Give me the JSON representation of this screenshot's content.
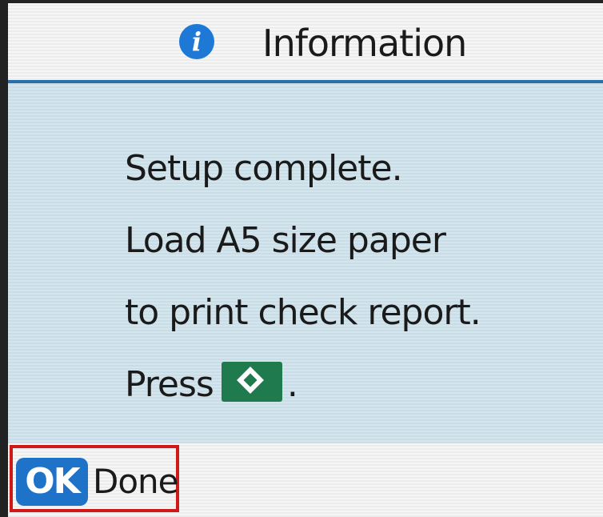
{
  "header": {
    "icon": "info-icon",
    "icon_glyph": "i",
    "title": "Information"
  },
  "message": {
    "line1": "Setup complete.",
    "line2": "Load A5 size paper",
    "line3": "to print check report.",
    "line4_prefix": "Press",
    "line4_icon": "start-diamond-icon",
    "line4_suffix": "."
  },
  "footer": {
    "ok_label": "OK",
    "done_label": "Done"
  },
  "colors": {
    "header_divider": "#2b6fa8",
    "info_icon": "#1d78d6",
    "ok_badge": "#1e73c8",
    "start_key": "#1f7a4e",
    "highlight_box": "#d01818"
  }
}
